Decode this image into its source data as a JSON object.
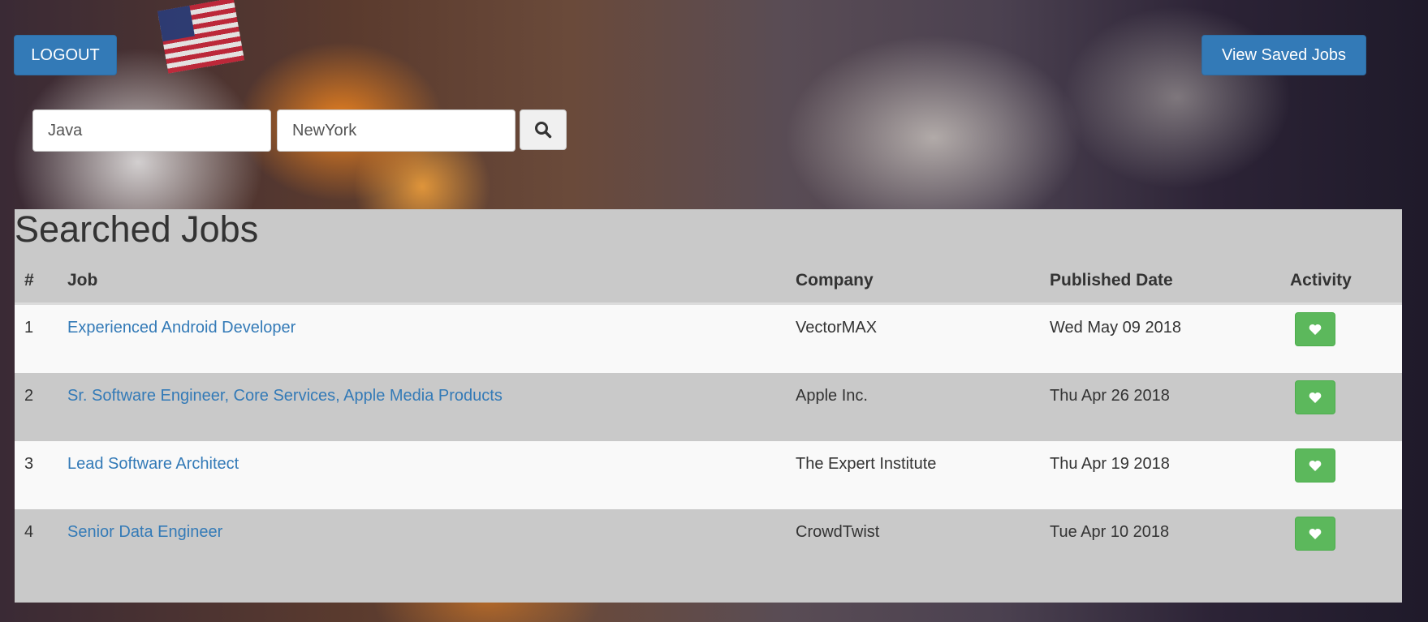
{
  "header": {
    "logout_label": "LOGOUT",
    "saved_jobs_label": "View Saved Jobs"
  },
  "search": {
    "job_value": "Java",
    "location_value": "NewYork",
    "search_icon": "search-icon"
  },
  "results": {
    "title": "Searched Jobs",
    "columns": [
      "#",
      "Job",
      "Company",
      "Published Date",
      "Activity"
    ],
    "rows": [
      {
        "num": "1",
        "job": "Experienced Android Developer",
        "company": "VectorMAX",
        "date": "Wed May 09 2018",
        "action_icon": "heart-icon"
      },
      {
        "num": "2",
        "job": "Sr. Software Engineer, Core Services, Apple Media Products",
        "company": "Apple Inc.",
        "date": "Thu Apr 26 2018",
        "action_icon": "heart-icon"
      },
      {
        "num": "3",
        "job": "Lead Software Architect",
        "company": "The Expert Institute",
        "date": "Thu Apr 19 2018",
        "action_icon": "heart-icon"
      },
      {
        "num": "4",
        "job": "Senior Data Engineer",
        "company": "CrowdTwist",
        "date": "Tue Apr 10 2018",
        "action_icon": "heart-icon"
      }
    ]
  },
  "colors": {
    "primary": "#337ab7",
    "success": "#5cb85c",
    "panel": "#c9c9c9",
    "row_alt": "#f9f9f9"
  }
}
